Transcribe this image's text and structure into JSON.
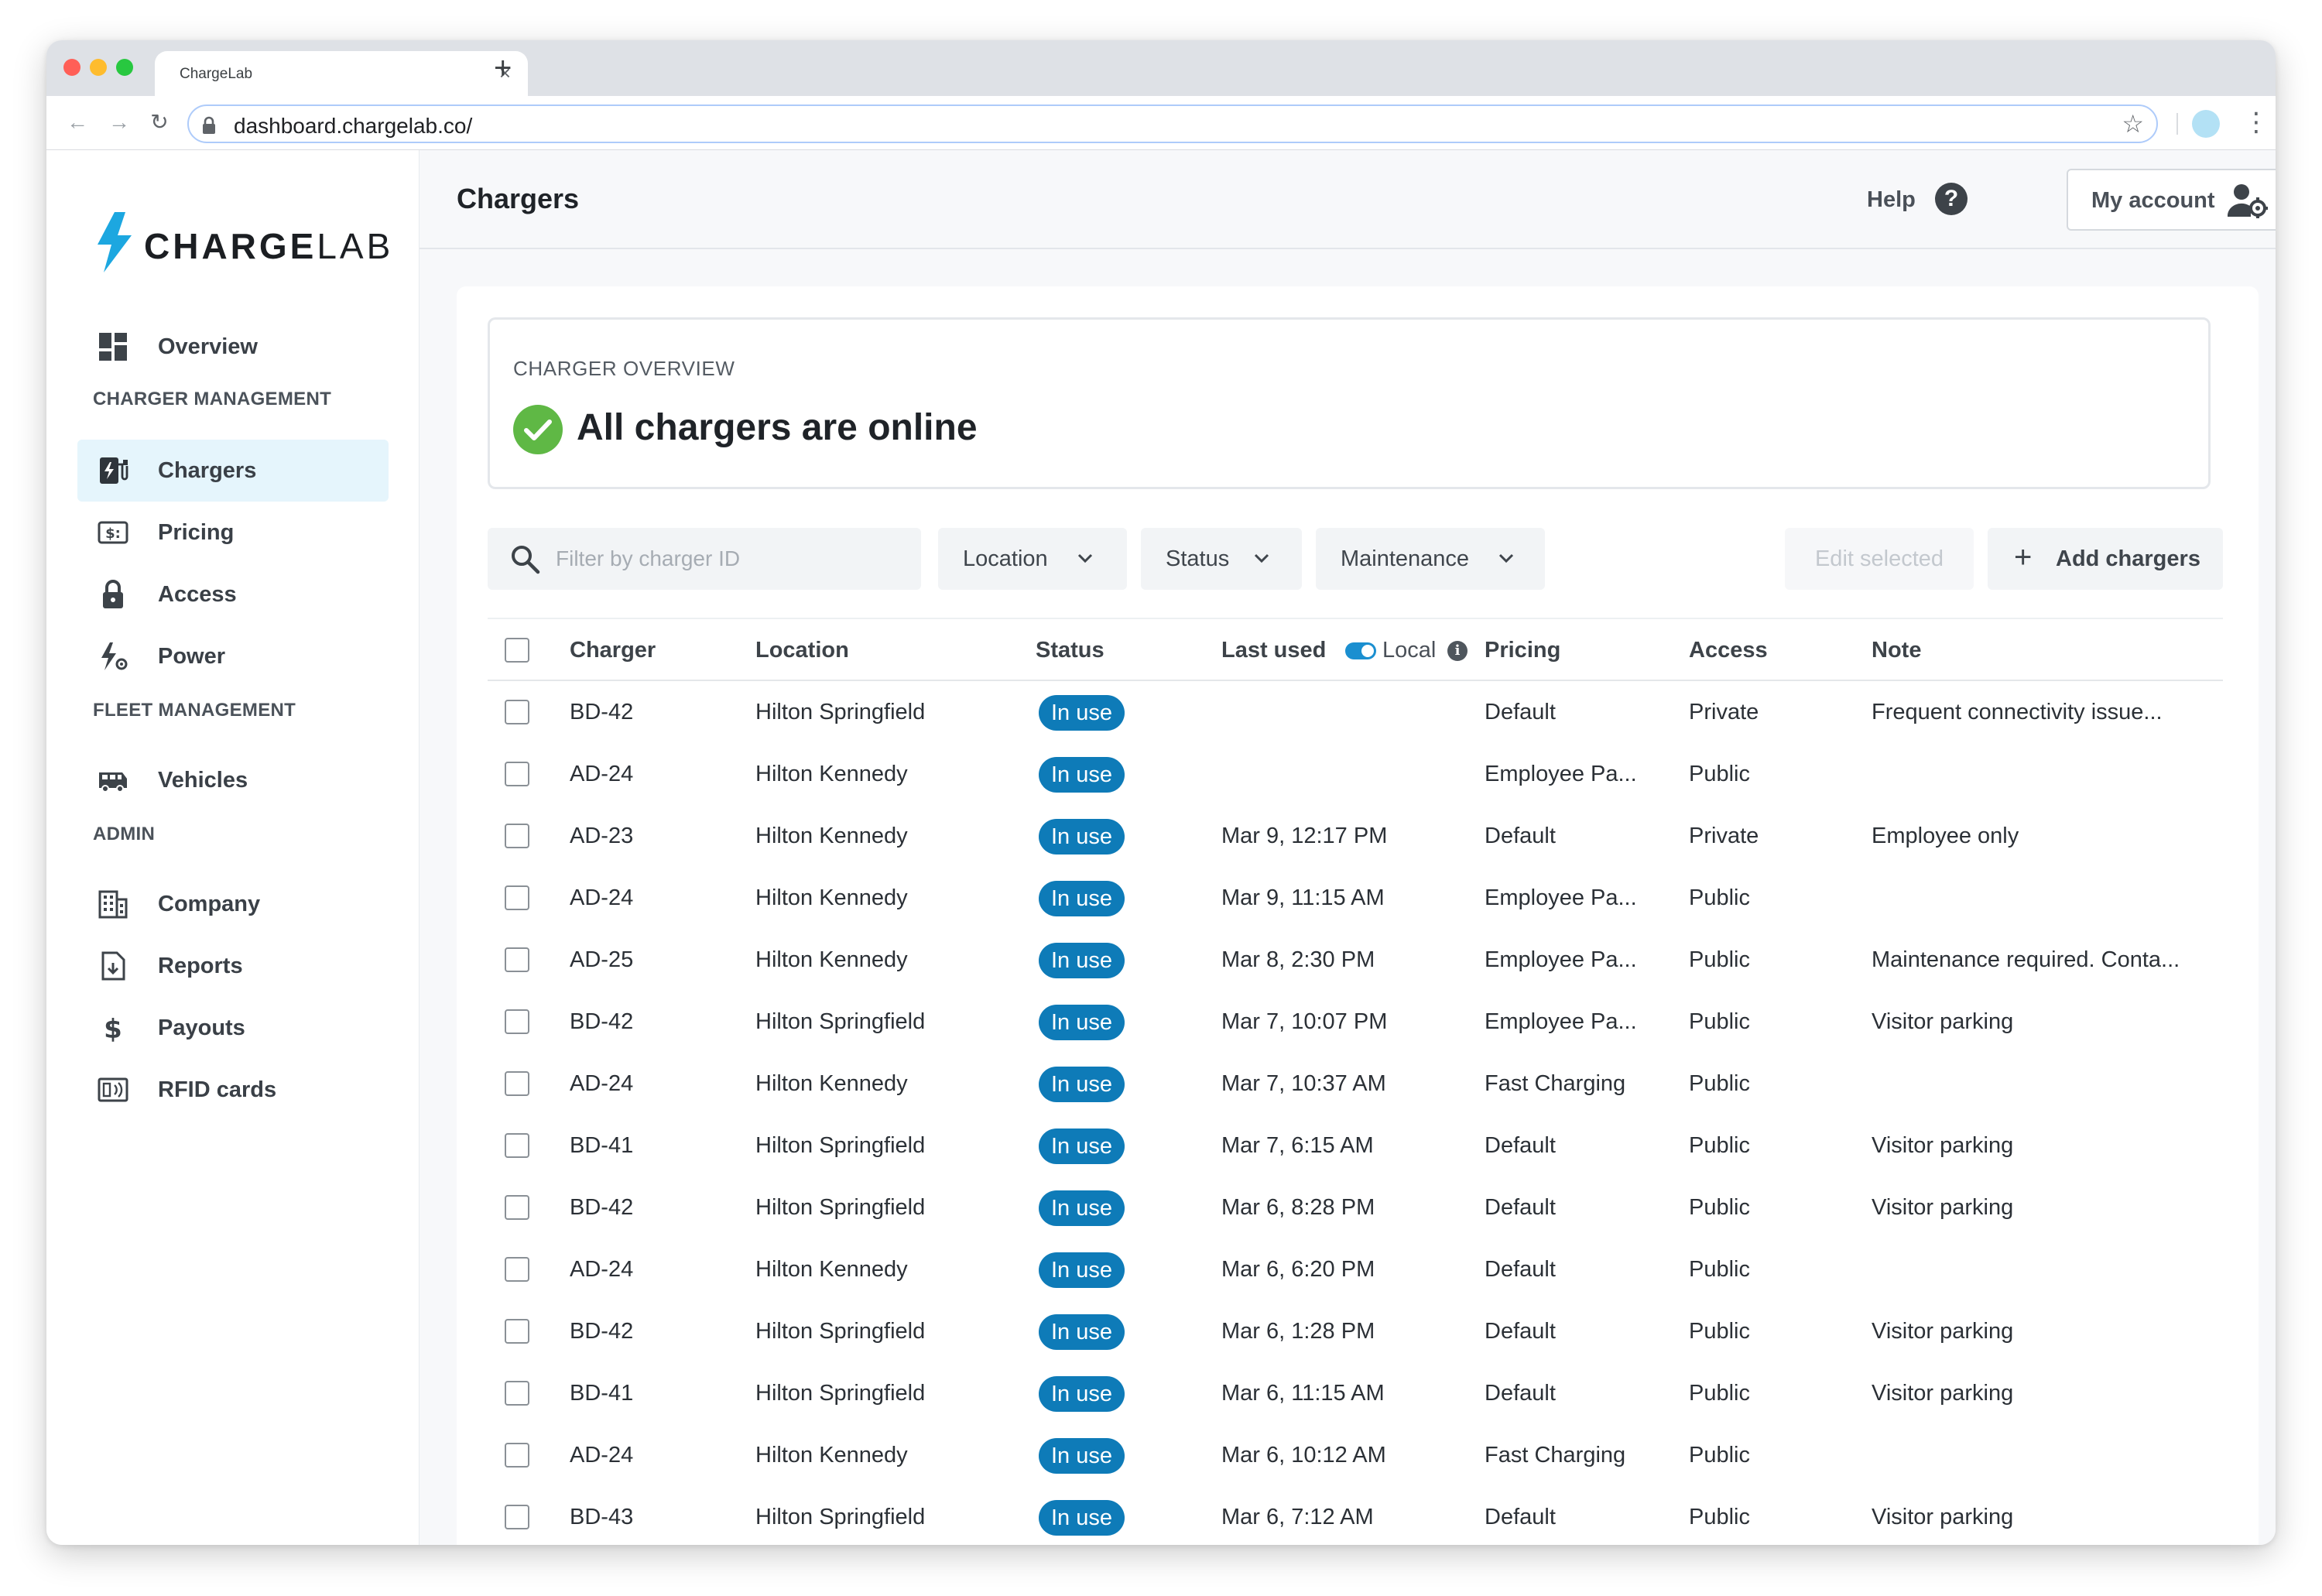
{
  "browser": {
    "tab_title": "ChargeLab",
    "url": "dashboard.chargelab.co/"
  },
  "brand": {
    "name_bold": "CHARGE",
    "name_light": "LAB",
    "accent": "#1ca7e0"
  },
  "sidebar": {
    "overview": {
      "label": "Overview",
      "icon": "dashboard-icon"
    },
    "sections": [
      {
        "title": "CHARGER MANAGEMENT",
        "items": [
          {
            "label": "Chargers",
            "icon": "ev-charger-icon",
            "active": true
          },
          {
            "label": "Pricing",
            "icon": "price-tag-icon"
          },
          {
            "label": "Access",
            "icon": "lock-icon"
          },
          {
            "label": "Power",
            "icon": "power-settings-icon"
          }
        ]
      },
      {
        "title": "FLEET MANAGEMENT",
        "items": [
          {
            "label": "Vehicles",
            "icon": "bus-icon"
          }
        ]
      },
      {
        "title": "ADMIN",
        "items": [
          {
            "label": "Company",
            "icon": "building-icon"
          },
          {
            "label": "Reports",
            "icon": "report-download-icon"
          },
          {
            "label": "Payouts",
            "icon": "dollar-icon"
          },
          {
            "label": "RFID cards",
            "icon": "rfid-card-icon"
          }
        ]
      }
    ]
  },
  "header": {
    "title": "Chargers",
    "help_label": "Help",
    "help_glyph": "?",
    "account_label": "My account"
  },
  "overview": {
    "label": "CHARGER OVERVIEW",
    "message": "All chargers are online",
    "status_color": "#5fb845"
  },
  "toolbar": {
    "search_placeholder": "Filter by charger ID",
    "filters": [
      {
        "label": "Location"
      },
      {
        "label": "Status"
      },
      {
        "label": "Maintenance"
      }
    ],
    "edit_label": "Edit selected",
    "add_label": "Add chargers"
  },
  "table": {
    "columns": {
      "charger": "Charger",
      "location": "Location",
      "status": "Status",
      "last_used": "Last used",
      "local_toggle": "Local",
      "pricing": "Pricing",
      "access": "Access",
      "note": "Note"
    },
    "status_color": "#0e7bb8",
    "rows": [
      {
        "charger": "BD-42",
        "location": "Hilton Springfield",
        "status": "In use",
        "last_used": "",
        "pricing": "Default",
        "access": "Private",
        "note": "Frequent connectivity issue..."
      },
      {
        "charger": "AD-24",
        "location": "Hilton Kennedy",
        "status": "In use",
        "last_used": "",
        "pricing": "Employee Pa...",
        "access": "Public",
        "note": ""
      },
      {
        "charger": "AD-23",
        "location": "Hilton Kennedy",
        "status": "In use",
        "last_used": "Mar 9, 12:17 PM",
        "pricing": "Default",
        "access": "Private",
        "note": "Employee only"
      },
      {
        "charger": "AD-24",
        "location": "Hilton Kennedy",
        "status": "In use",
        "last_used": "Mar 9, 11:15 AM",
        "pricing": "Employee Pa...",
        "access": "Public",
        "note": ""
      },
      {
        "charger": "AD-25",
        "location": "Hilton Kennedy",
        "status": "In use",
        "last_used": "Mar 8, 2:30 PM",
        "pricing": "Employee Pa...",
        "access": "Public",
        "note": "Maintenance required. Conta..."
      },
      {
        "charger": "BD-42",
        "location": "Hilton Springfield",
        "status": "In use",
        "last_used": "Mar 7, 10:07 PM",
        "pricing": "Employee Pa...",
        "access": "Public",
        "note": "Visitor parking"
      },
      {
        "charger": "AD-24",
        "location": "Hilton Kennedy",
        "status": "In use",
        "last_used": "Mar 7, 10:37 AM",
        "pricing": "Fast Charging",
        "access": "Public",
        "note": ""
      },
      {
        "charger": "BD-41",
        "location": "Hilton Springfield",
        "status": "In use",
        "last_used": "Mar 7, 6:15 AM",
        "pricing": "Default",
        "access": "Public",
        "note": "Visitor parking"
      },
      {
        "charger": "BD-42",
        "location": "Hilton Springfield",
        "status": "In use",
        "last_used": "Mar 6, 8:28 PM",
        "pricing": "Default",
        "access": "Public",
        "note": "Visitor parking"
      },
      {
        "charger": "AD-24",
        "location": "Hilton Kennedy",
        "status": "In use",
        "last_used": "Mar 6, 6:20 PM",
        "pricing": "Default",
        "access": "Public",
        "note": ""
      },
      {
        "charger": "BD-42",
        "location": "Hilton Springfield",
        "status": "In use",
        "last_used": "Mar 6, 1:28 PM",
        "pricing": "Default",
        "access": "Public",
        "note": "Visitor parking"
      },
      {
        "charger": "BD-41",
        "location": "Hilton Springfield",
        "status": "In use",
        "last_used": "Mar 6, 11:15 AM",
        "pricing": "Default",
        "access": "Public",
        "note": "Visitor parking"
      },
      {
        "charger": "AD-24",
        "location": "Hilton Kennedy",
        "status": "In use",
        "last_used": "Mar 6, 10:12 AM",
        "pricing": "Fast Charging",
        "access": "Public",
        "note": ""
      },
      {
        "charger": "BD-43",
        "location": "Hilton Springfield",
        "status": "In use",
        "last_used": "Mar 6, 7:12 AM",
        "pricing": "Default",
        "access": "Public",
        "note": "Visitor parking"
      }
    ]
  }
}
